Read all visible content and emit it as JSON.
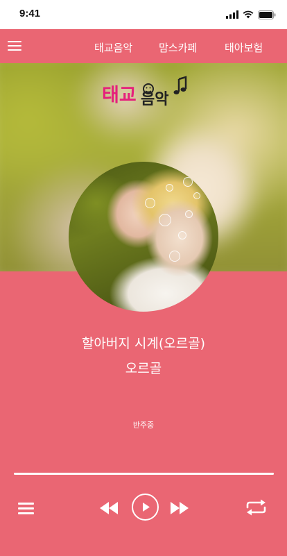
{
  "status_bar": {
    "time": "9:41",
    "icons": [
      "signal-icon",
      "wifi-icon",
      "battery-icon"
    ]
  },
  "header": {
    "menu_icon": "hamburger-icon",
    "nav": [
      {
        "label": "태교음악"
      },
      {
        "label": "맘스카페"
      },
      {
        "label": "태아보험"
      }
    ]
  },
  "hero": {
    "logo_text": "태교음악",
    "logo_icon": "music-note-icon"
  },
  "track": {
    "title": "할아버지 시계(오르골)",
    "artist": "오르골",
    "status": "반주중",
    "progress": 1.0
  },
  "controls": {
    "playlist_icon": "playlist-icon",
    "prev_icon": "rewind-icon",
    "play_icon": "play-icon",
    "next_icon": "fast-forward-icon",
    "repeat_icon": "repeat-icon"
  },
  "colors": {
    "brand_pink": "#ea6673",
    "white": "#ffffff"
  }
}
